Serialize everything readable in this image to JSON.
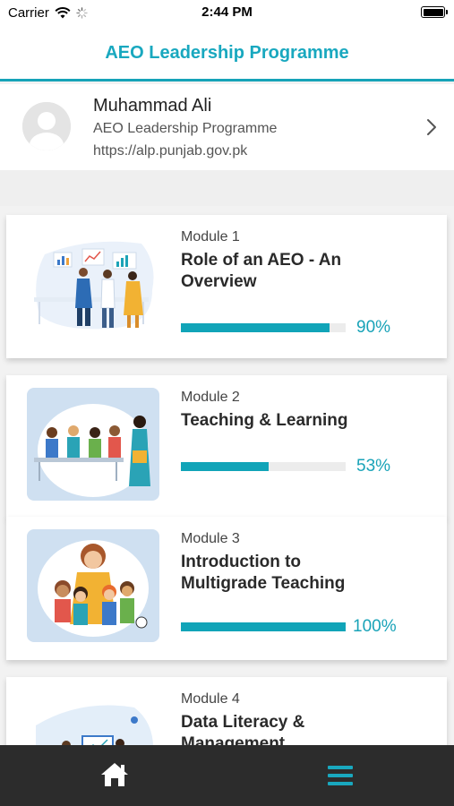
{
  "status_bar": {
    "carrier": "Carrier",
    "time": "2:44 PM"
  },
  "header": {
    "title": "AEO Leadership Programme"
  },
  "profile": {
    "name": "Muhammad Ali",
    "programme": "AEO Leadership Programme",
    "url": "https://alp.punjab.gov.pk"
  },
  "modules": [
    {
      "label": "Module 1",
      "title_line1": "Role of an AEO - An",
      "title_line2": "Overview",
      "progress": 0.9,
      "progress_text": "90%"
    },
    {
      "label": "Module 2",
      "title_line1": "Teaching & Learning",
      "title_line2": "",
      "progress": 0.53,
      "progress_text": "53%"
    },
    {
      "label": "Module 3",
      "title_line1": "Introduction to",
      "title_line2": "Multigrade Teaching",
      "progress": 1.0,
      "progress_text": "100%"
    },
    {
      "label": "Module 4",
      "title_line1": "Data Literacy &",
      "title_line2": "Management",
      "progress": null,
      "progress_text": ""
    }
  ],
  "colors": {
    "accent": "#19a8bf",
    "progress": "#11a4b8",
    "tab_bar": "#2c2c2c",
    "menu_icon": "#19a8bf"
  },
  "tabs": [
    {
      "icon": "home-icon"
    },
    {
      "icon": "menu-icon"
    }
  ]
}
